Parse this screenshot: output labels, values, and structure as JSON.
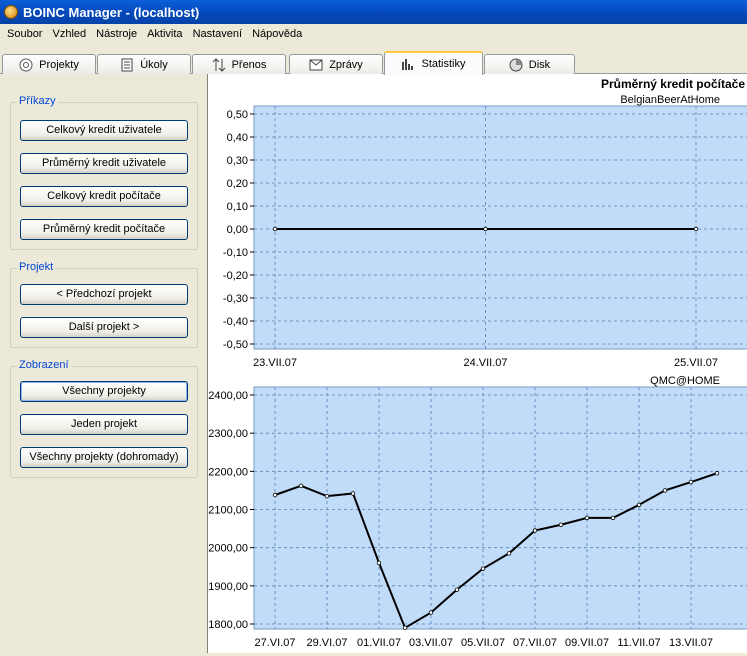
{
  "window": {
    "title": "BOINC Manager - (localhost)"
  },
  "menu": [
    "Soubor",
    "Vzhled",
    "Nástroje",
    "Aktivita",
    "Nastavení",
    "Nápověda"
  ],
  "tabs": [
    {
      "label": "Projekty",
      "icon": "projects-icon"
    },
    {
      "label": "Úkoly",
      "icon": "tasks-icon"
    },
    {
      "label": "Přenos",
      "icon": "transfer-icon"
    },
    {
      "label": "Zprávy",
      "icon": "messages-icon"
    },
    {
      "label": "Statistiky",
      "icon": "statistics-icon",
      "active": true
    },
    {
      "label": "Disk",
      "icon": "disk-icon"
    }
  ],
  "commands": {
    "label": "Příkazy",
    "buttons": [
      "Celkový kredit uživatele",
      "Průměrný kredit uživatele",
      "Celkový kredit počítače",
      "Průměrný kredit počítače"
    ]
  },
  "project": {
    "label": "Projekt",
    "buttons": [
      "< Předchozí projekt",
      "Další projekt >"
    ]
  },
  "display": {
    "label": "Zobrazení",
    "buttons": [
      "Všechny projekty",
      "Jeden projekt",
      "Všechny projekty (dohromady)"
    ]
  },
  "stats_title": "Průměrný kredit počítače",
  "colors": {
    "plot_bg": "#c0dcf8",
    "grid": "#5a7fb5",
    "line": "#000000",
    "titlebar": "#0a5fd8"
  },
  "chart_data": [
    {
      "type": "line",
      "title": "BelgianBeerAtHome",
      "x": [
        "23.VII.07",
        "24.VII.07",
        "25.VII.07"
      ],
      "y": [
        0,
        0,
        0
      ],
      "ylim": [
        -0.5,
        0.5
      ],
      "yticks": [
        "0,50",
        "0,40",
        "0,30",
        "0,20",
        "0,10",
        "0,00",
        "-0,10",
        "-0,20",
        "-0,30",
        "-0,40",
        "-0,50"
      ],
      "xticks": [
        "23.VII.07",
        "24.VII.07",
        "25.VII.07"
      ],
      "grid": true
    },
    {
      "type": "line",
      "title": "QMC@HOME",
      "x": [
        "27.VI.07",
        "28.VI.07",
        "29.VI.07",
        "30.VI.07",
        "01.VII.07",
        "02.VII.07",
        "03.VII.07",
        "04.VII.07",
        "05.VII.07",
        "06.VII.07",
        "07.VII.07",
        "08.VII.07",
        "09.VII.07",
        "10.VII.07",
        "11.VII.07",
        "12.VII.07",
        "13.VII.07",
        "14.VII.07"
      ],
      "y": [
        2138,
        2162,
        2135,
        2142,
        1960,
        1790,
        1830,
        1890,
        1945,
        1985,
        2045,
        2060,
        2078,
        2078,
        2112,
        2150,
        2172,
        2195
      ],
      "ylim": [
        1780,
        2410
      ],
      "yticks": [
        "2400,00",
        "2300,00",
        "2200,00",
        "2100,00",
        "2000,00",
        "1900,00",
        "1800,00"
      ],
      "xticks": [
        "27.VI.07",
        "29.VI.07",
        "01.VII.07",
        "03.VII.07",
        "05.VII.07",
        "07.VII.07",
        "09.VII.07",
        "11.VII.07",
        "13.VII.07"
      ],
      "grid": true
    }
  ]
}
